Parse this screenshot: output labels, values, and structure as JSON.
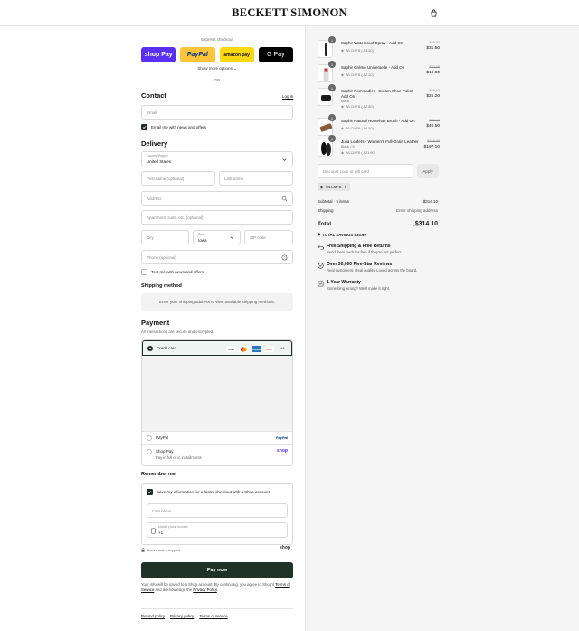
{
  "header": {
    "brand": "BECKETT SIMONON",
    "cart_icon": "bag-icon"
  },
  "express": {
    "title": "Express checkout",
    "buttons": [
      "shop Pay",
      "PayPal",
      "amazon pay",
      "G Pay"
    ],
    "more_options": "Show more options",
    "or": "OR"
  },
  "contact": {
    "heading": "Contact",
    "login": "Log in",
    "email_placeholder": "Email",
    "email_news": "Email me with news and offers"
  },
  "delivery": {
    "heading": "Delivery",
    "country_label": "Country/Region",
    "country_value": "United States",
    "first_name": "First name (optional)",
    "last_name": "Last name",
    "address": "Address",
    "apartment": "Apartment, suite, etc. (optional)",
    "city": "City",
    "state_label": "State",
    "state_value": "Iowa",
    "zip": "ZIP code",
    "phone": "Phone (optional)",
    "text_news": "Text me with news and offers"
  },
  "shipping_method": {
    "heading": "Shipping method",
    "placeholder": "Enter your shipping address to view available shipping methods."
  },
  "payment": {
    "heading": "Payment",
    "subtitle": "All transactions are secure and encrypted.",
    "credit_card": "Credit card",
    "card_logos": [
      "VISA",
      "MC",
      "AMEX",
      "DISC"
    ],
    "more_cards": "+4",
    "paypal": "PayPal",
    "paypal_logo": "PayPal",
    "shop_pay": "Shop Pay",
    "shop_pay_sub": "Pay in full or in installments",
    "shop_logo": "shop"
  },
  "remember": {
    "heading": "Remember me",
    "save_info": "Save my information for a faster checkout with a Shop account",
    "first_name": "First name",
    "mobile_label": "Mobile phone number",
    "mobile_value": "+1",
    "secure": "Secure and encrypted",
    "shop_logo": "shop"
  },
  "pay_now": "Pay now",
  "legal": {
    "text1": "Your info will be saved to a Shop account. By continuing, you agree to Shop's ",
    "tos": "Terms of Service",
    "text2": " and acknowledge the ",
    "privacy": "Privacy Policy",
    "text3": "."
  },
  "footer": {
    "links": [
      "Refund policy",
      "Privacy policy",
      "Terms of service"
    ]
  },
  "cart": {
    "items": [
      {
        "qty": "1",
        "name": "Saphir Waterproof Spray - Add On",
        "variant": "",
        "discount": "WLCMFB (-$3.50)",
        "original": "$35.00",
        "price": "$31.50"
      },
      {
        "qty": "1",
        "name": "Saphir Crème Universelle - Add On",
        "variant": "",
        "discount": "WLCMFB (-$2.20)",
        "original": "$22.00",
        "price": "$19.80"
      },
      {
        "qty": "1",
        "name": "Saphir Pommadier - Cream Shoe Polish - Add On",
        "variant": "Black",
        "discount": "WLCMFB (-$2.80)",
        "original": "$28.00",
        "price": "$25.20"
      },
      {
        "qty": "1",
        "name": "Saphir Natural Horsehair Brush - Add On",
        "variant": "",
        "discount": "WLCMFB (-$4.50)",
        "original": "$45.00",
        "price": "$40.50"
      },
      {
        "qty": "1",
        "name": "Julia Loafers - Women's Full-Grain Leather",
        "variant": "Black / 5",
        "discount": "WLCMFB (-$21.90)",
        "original": "$219.00",
        "price": "$197.10"
      }
    ],
    "discount_placeholder": "Discount code or gift card",
    "apply": "Apply",
    "applied_code": "WLCMFB",
    "subtotal_label": "Subtotal · 5 items",
    "subtotal_value": "$314.10",
    "shipping_label": "Shipping",
    "shipping_value": "Enter shipping address",
    "total_label": "Total",
    "currency": "USD",
    "total_value": "$314.10",
    "savings": "TOTAL SAVINGS $34.90"
  },
  "features": [
    {
      "icon": "return-icon",
      "title": "Free Shipping & Free Returns",
      "desc": "Send them back for free if they're not perfect."
    },
    {
      "icon": "review-icon",
      "title": "Over 30,000 Five-Star Reviews",
      "desc": "Real customers. Real quality. Loved across the board."
    },
    {
      "icon": "warranty-icon",
      "title": "1-Year Warranty",
      "desc": "Something wrong? We'll make it right."
    }
  ]
}
